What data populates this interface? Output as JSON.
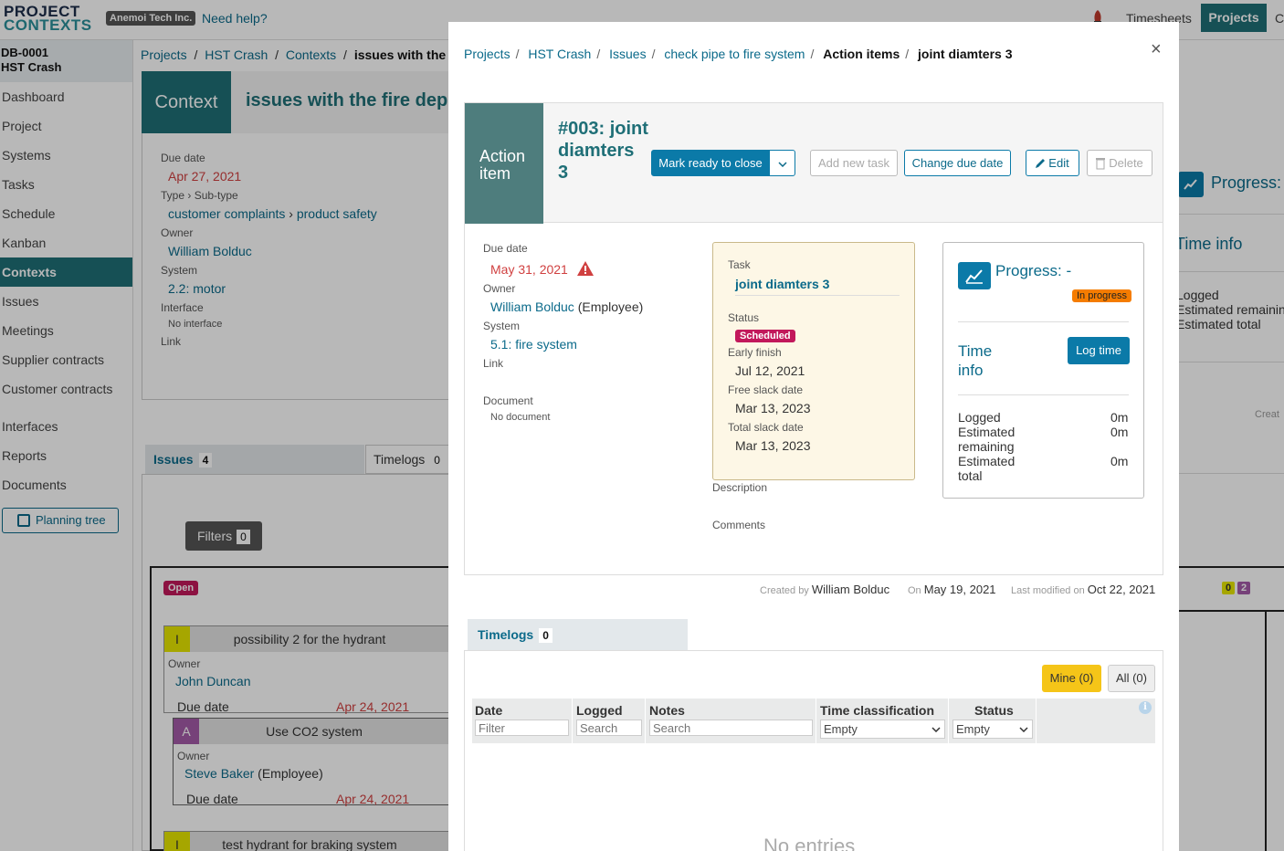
{
  "topbar": {
    "logo_line1": "PROJECT",
    "logo_line2": "CONTEXTS",
    "org": "Anemoi Tech Inc.",
    "help": "Need help?",
    "tabs": [
      "Timesheets",
      "Projects",
      "C"
    ]
  },
  "sidebar": {
    "project_code": "DB-0001",
    "project_name": "HST Crash",
    "items": [
      "Dashboard",
      "Project",
      "Systems",
      "Tasks",
      "Schedule",
      "Kanban",
      "Contexts",
      "Issues",
      "Meetings",
      "Supplier contracts",
      "Customer contracts",
      "Interfaces",
      "Reports",
      "Documents"
    ],
    "active": "Contexts",
    "planning_tree": "Planning tree"
  },
  "background": {
    "breadcrumbs": [
      "Projects",
      "/",
      "HST Crash",
      "/",
      "Contexts",
      "/",
      "issues with the"
    ],
    "context_label": "Context",
    "context_title": "issues with the fire dep",
    "due_date_label": "Due date",
    "due_date": "Apr 27, 2021",
    "type_label": "Type",
    "subtype_label": "Sub-type",
    "type": "customer complaints",
    "subtype": "product safety",
    "owner_label": "Owner",
    "owner": "William Bolduc",
    "system_label": "System",
    "system": "2.2: motor",
    "interface_label": "Interface",
    "interface": "No interface",
    "link_label": "Link",
    "issues_tab": "Issues",
    "issues_count": "4",
    "timelogs_tab": "Timelogs",
    "timelogs_count": "0",
    "filters": "Filters",
    "filters_count": "0",
    "open_badge": "Open",
    "card1": {
      "tag": "I",
      "title": "possibility 2 for the hydrant",
      "owner_label": "Owner",
      "owner": "John Duncan",
      "due_label": "Due date",
      "due": "Apr 24, 2021"
    },
    "card2": {
      "tag": "A",
      "title": "Use CO2 system",
      "owner_label": "Owner",
      "owner": "Steve Baker",
      "owner_role": "(Employee)",
      "due_label": "Due date",
      "due": "Apr 24, 2021"
    },
    "card3": {
      "tag": "I",
      "title": "test hydrant for braking system"
    },
    "right_progress": "Progress:",
    "right_timeinfo": "Time info",
    "right_logged": "Logged",
    "right_est_rem": "Estimated remainin",
    "right_est_total": "Estimated total",
    "right_create": "Creat",
    "right_badges": [
      "0",
      "2"
    ]
  },
  "modal": {
    "breadcrumbs": [
      "Projects",
      "HST Crash",
      "Issues",
      "check pipe to fire system",
      "Action items",
      "joint diamters 3"
    ],
    "close": "×",
    "label": "Action item",
    "title": "#003: joint diamters 3",
    "buttons": {
      "mark_ready": "Mark ready to close",
      "add_task": "Add new task",
      "change_due": "Change due date",
      "edit": "Edit",
      "delete": "Delete"
    },
    "due_date_label": "Due date",
    "due_date": "May 31, 2021",
    "owner_label": "Owner",
    "owner": "William Bolduc",
    "owner_role": "(Employee)",
    "system_label": "System",
    "system": "5.1: fire system",
    "link_label": "Link",
    "document_label": "Document",
    "document": "No document",
    "task_label": "Task",
    "task": "joint diamters 3",
    "status_label": "Status",
    "status": "Scheduled",
    "early_finish_label": "Early finish",
    "early_finish": "Jul 12, 2021",
    "free_slack_label": "Free slack date",
    "free_slack": "Mar 13, 2023",
    "total_slack_label": "Total slack date",
    "total_slack": "Mar 13, 2023",
    "description_label": "Description",
    "comments_label": "Comments",
    "progress_label": "Progress: -",
    "progress_status": "In progress",
    "time_info": "Time info",
    "log_time": "Log time",
    "logged_label": "Logged",
    "logged": "0m",
    "est_remaining_label": "Estimated remaining",
    "est_remaining": "0m",
    "est_total_label": "Estimated total",
    "est_total": "0m",
    "created_by_label": "Created by",
    "created_by": "William Bolduc",
    "on_label": "On",
    "created_on": "May 19, 2021",
    "modified_label": "Last modified on",
    "modified_on": "Oct 22, 2021",
    "timelogs_tab": "Timelogs",
    "timelogs_count": "0",
    "mine": "Mine (0)",
    "all": "All (0)",
    "columns": [
      "Date",
      "Logged",
      "Notes",
      "Time classification",
      "Status"
    ],
    "filter_placeholder": "Filter",
    "search_placeholder": "Search",
    "empty_option": "Empty",
    "no_entries": "No entries"
  },
  "colors": {
    "teal": "#1f6f77",
    "link": "#0b6a8a",
    "primary_button": "#0b7aa8",
    "overdue": "#d04040",
    "scheduled": "#c2185b",
    "in_progress": "#f57c00",
    "mine": "#f5c518"
  }
}
